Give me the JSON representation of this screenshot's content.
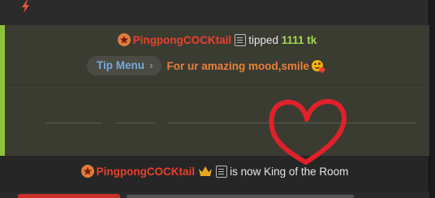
{
  "tip_event": {
    "username": "PingpongCOCKtail",
    "action_text": "tipped",
    "amount": "1111 tk"
  },
  "tip_menu": {
    "label": "Tip Menu",
    "chevron": "›",
    "message": "For ur amazing mood,smile"
  },
  "king_event": {
    "username": "PingpongCOCKtail",
    "text": "is now King of the Room"
  },
  "icons": {
    "top": "lightning-bolt-icon",
    "user_badge": "star-badge-icon",
    "notes": "document-icon",
    "crown": "crown-icon",
    "emoji": "smiling-face-with-heart-emoji"
  },
  "colors": {
    "accent_green": "#8fc23f",
    "username_red": "#e8402f",
    "tip_amount": "#a6d84d",
    "tip_message": "#e8803a",
    "heart_overlay": "#e0212b"
  }
}
